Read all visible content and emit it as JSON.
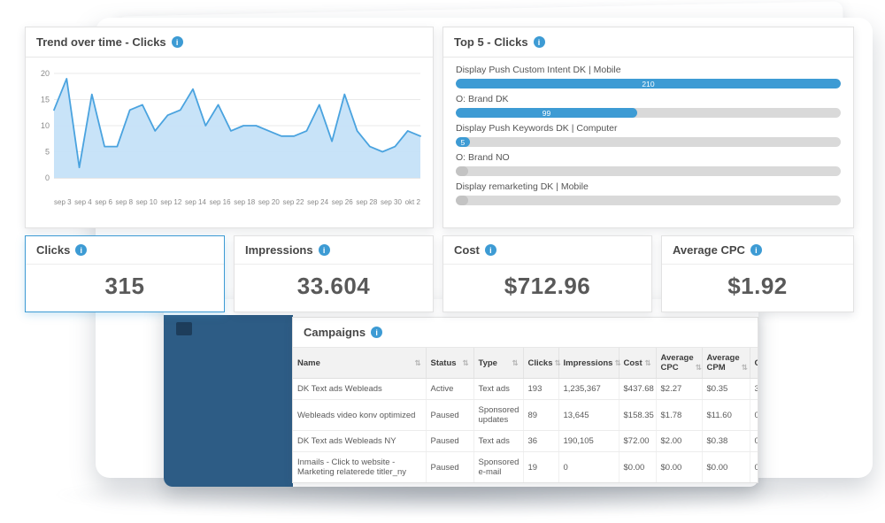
{
  "colors": {
    "accent": "#3d9bd4",
    "bar_track": "#d9d9d9",
    "chart_fill": "#c5e2f8",
    "chart_line": "#4aa3df",
    "link": "#3a7ab8",
    "sidebar": "#2d5c85"
  },
  "icons": {
    "info_glyph": "i",
    "sort_glyph": "⇅"
  },
  "chart_data": [
    {
      "type": "area",
      "title": "Trend over time - Clicks",
      "values": [
        13,
        19,
        2,
        16,
        6,
        6,
        13,
        14,
        9,
        12,
        13,
        17,
        10,
        14,
        9,
        10,
        10,
        9,
        8,
        8,
        9,
        14,
        7,
        16,
        9,
        6,
        5,
        6,
        9,
        8
      ],
      "x_ticks": [
        "sep 3",
        "sep 4",
        "sep 6",
        "sep 8",
        "sep 10",
        "sep 12",
        "sep 14",
        "sep 16",
        "sep 18",
        "sep 20",
        "sep 22",
        "sep 24",
        "sep 26",
        "sep 28",
        "sep 30",
        "okt 2"
      ],
      "y_ticks": [
        0,
        5,
        10,
        15,
        20
      ],
      "ylim": [
        0,
        20
      ],
      "grid": true,
      "legend": "none"
    },
    {
      "type": "bar",
      "title": "Top 5 - Clicks",
      "orientation": "horizontal",
      "max": 210,
      "bars": [
        {
          "label": "Display Push Custom Intent DK | Mobile",
          "value": 210,
          "display": "210"
        },
        {
          "label": "O: Brand DK",
          "value": 99,
          "display": "99"
        },
        {
          "label": "Display Push Keywords DK | Computer",
          "value": 5,
          "display": "5"
        },
        {
          "label": "O: Brand NO",
          "value": 0,
          "display": ""
        },
        {
          "label": "Display remarketing DK | Mobile",
          "value": 0,
          "display": ""
        }
      ]
    }
  ],
  "kpis": [
    {
      "label": "Clicks",
      "value": "315",
      "selected": true
    },
    {
      "label": "Impressions",
      "value": "33.604",
      "selected": false
    },
    {
      "label": "Cost",
      "value": "$712.96",
      "selected": false
    },
    {
      "label": "Average CPC",
      "value": "$1.92",
      "selected": false
    }
  ],
  "campaigns": {
    "title": "Campaigns",
    "columns": [
      "Name",
      "Status",
      "Type",
      "Clicks",
      "Impressions",
      "Cost",
      "Average CPC",
      "Average CPM",
      "C"
    ],
    "rows": [
      [
        "DK Text ads Webleads",
        "Active",
        "Text ads",
        "193",
        "1,235,367",
        "$437.68",
        "$2.27",
        "$0.35",
        "3"
      ],
      [
        "Webleads video konv optimized",
        "Paused",
        "Sponsored updates",
        "89",
        "13,645",
        "$158.35",
        "$1.78",
        "$11.60",
        "0"
      ],
      [
        "DK Text ads Webleads NY",
        "Paused",
        "Text ads",
        "36",
        "190,105",
        "$72.00",
        "$2.00",
        "$0.38",
        "0"
      ],
      [
        "Inmails - Click to website - Marketing relaterede titler_ny",
        "Paused",
        "Sponsored e-mail",
        "19",
        "0",
        "$0.00",
        "$0.00",
        "$0.00",
        "0"
      ]
    ]
  }
}
